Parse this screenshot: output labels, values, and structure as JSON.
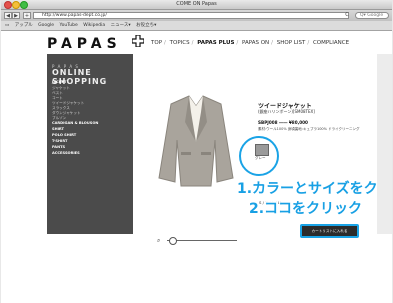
{
  "window": {
    "title": "COME ON Papas"
  },
  "toolbar": {
    "back": "◀",
    "forward": "▶",
    "add": "+",
    "url": "http://www.papas-dept.co.jp/",
    "reload": "C",
    "search_placeholder": "Q▾ Google"
  },
  "bookmarks": [
    "アップル",
    "Google",
    "YouTube",
    "Wikipedia",
    "ニュース▾",
    "お役立ち▾"
  ],
  "site": {
    "logo": "PAPAS",
    "nav": [
      "TOP",
      "TOPICS",
      "PAPAS PLUS",
      "PAPAS ON",
      "SHOP LIST",
      "COMPLIANCE"
    ],
    "nav_active": "PAPAS PLUS"
  },
  "sidebar": {
    "kicker": "P A P A S",
    "title": "ONLINE SHOPPING",
    "categories": [
      {
        "label": "JACKET",
        "head": true
      },
      {
        "label": "ジャケット",
        "head": false
      },
      {
        "label": "ベスト",
        "head": false
      },
      {
        "label": "コート",
        "head": false
      },
      {
        "label": "ツイードジャケット",
        "head": false
      },
      {
        "label": "スラックス",
        "head": false
      },
      {
        "label": "ダウンジャケット",
        "head": false
      },
      {
        "label": "ブルゾン",
        "head": false
      },
      {
        "label": "CARDIGAN & BLOUSON",
        "head": true
      },
      {
        "label": "SHIRT",
        "head": true
      },
      {
        "label": "POLO SHIRT",
        "head": true
      },
      {
        "label": "T-SHIRT",
        "head": true
      },
      {
        "label": "PANTS",
        "head": true
      },
      {
        "label": "ACCESSORIES",
        "head": true
      }
    ]
  },
  "product": {
    "title": "ツイードジャケット",
    "subtitle": "(銀座ハリンボーン)[SM08TEX]",
    "price": "SBPJ008 ―― ¥80,000",
    "desc": "素材:ウール100% 身頃裏地:キュプラ100% ドライクリーニング",
    "color_label": "グレー",
    "sizes": "S / M / L / LL",
    "cart_label": "カートリストに入れる"
  },
  "annotations": {
    "step1": "1.カラーとサイズをク",
    "step2": "2.ココをクリック"
  },
  "colors": {
    "accent": "#1aa3e6",
    "sidebar": "#4b4b4b"
  },
  "icons": {
    "zoom": "search-icon"
  }
}
